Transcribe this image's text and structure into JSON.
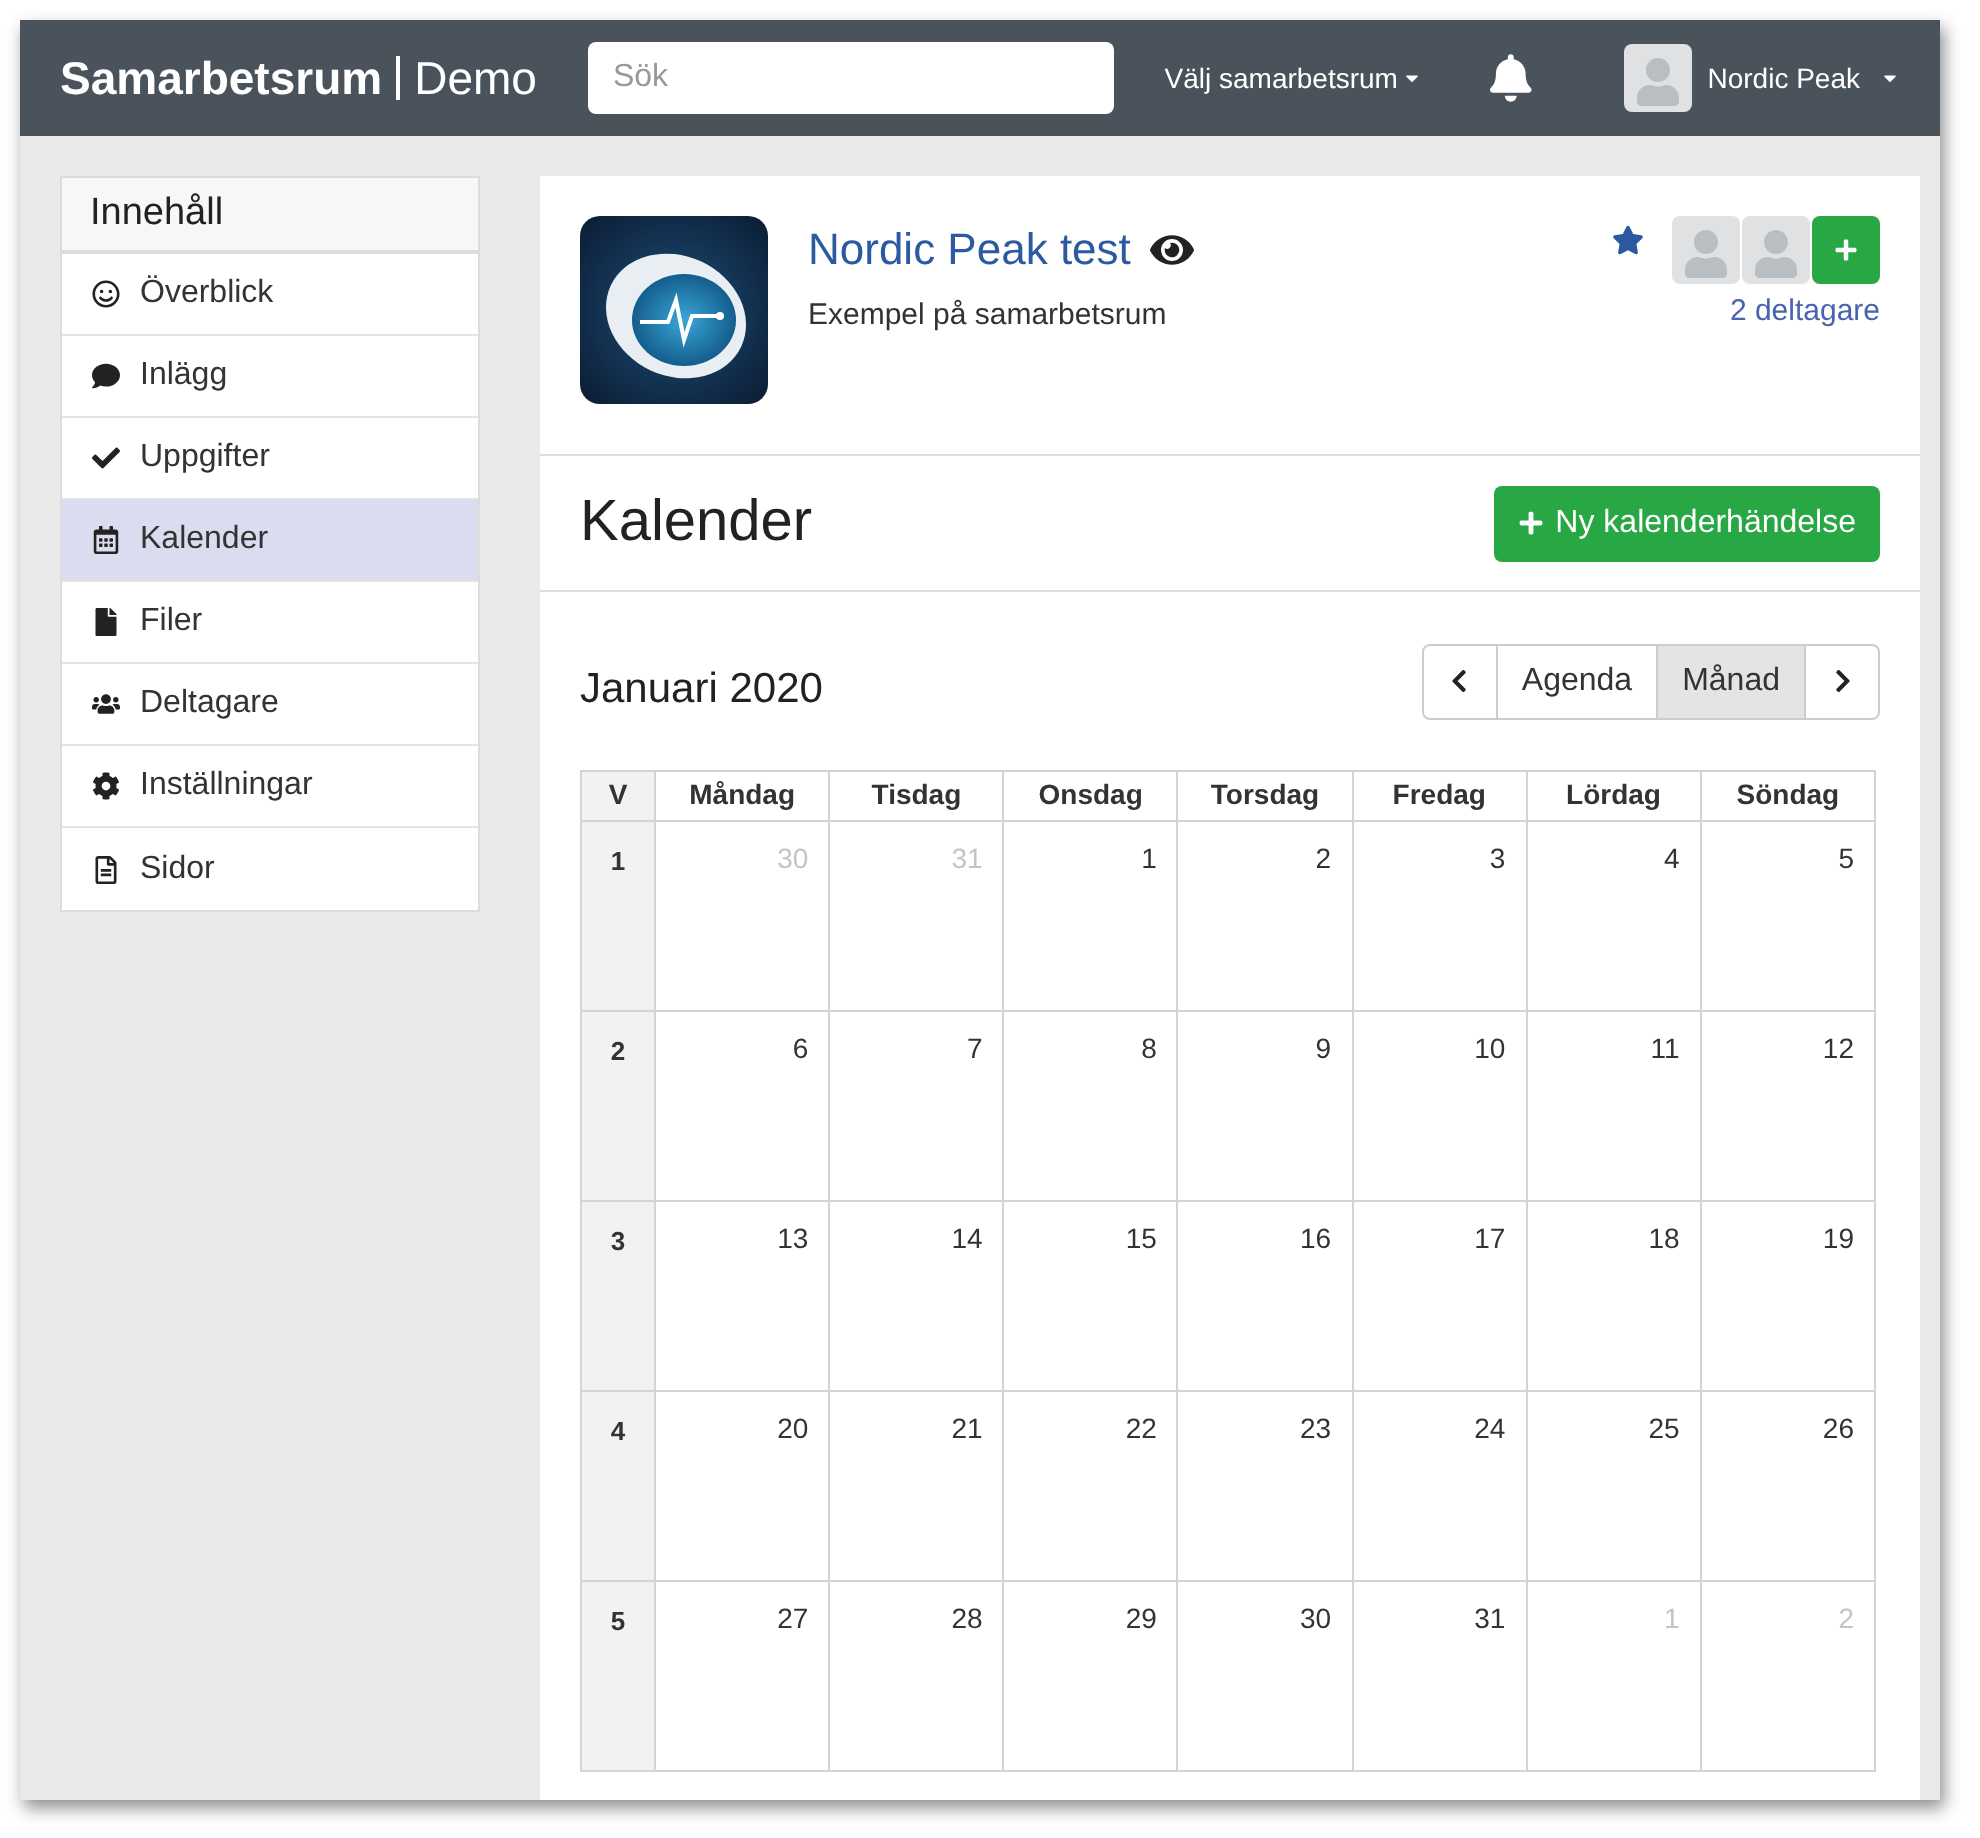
{
  "header": {
    "brand": "Samarbetsrum",
    "brand_suffix": "Demo",
    "search": {
      "placeholder": "Sök"
    },
    "workspace_menu": "Välj samarbetsrum",
    "user": "Nordic Peak"
  },
  "sidebar": {
    "title": "Innehåll",
    "items": [
      {
        "label": "Överblick",
        "selected": false
      },
      {
        "label": "Inlägg",
        "selected": false
      },
      {
        "label": "Uppgifter",
        "selected": false
      },
      {
        "label": "Kalender",
        "selected": true
      },
      {
        "label": "Filer",
        "selected": false
      },
      {
        "label": "Deltagare",
        "selected": false
      },
      {
        "label": "Inställningar",
        "selected": false
      },
      {
        "label": "Sidor",
        "selected": false
      }
    ]
  },
  "project": {
    "title": "Nordic Peak test",
    "subtitle": "Exempel på samarbetsrum",
    "participants": "2 deltagare"
  },
  "calendar": {
    "heading": "Kalender",
    "new_button": "Ny kalenderhändelse",
    "month": "Januari 2020",
    "views": [
      {
        "label": "Agenda",
        "selected": false
      },
      {
        "label": "Månad",
        "selected": true
      }
    ],
    "columns": [
      "V",
      "Måndag",
      "Tisdag",
      "Onsdag",
      "Torsdag",
      "Fredag",
      "Lördag",
      "Söndag"
    ],
    "weeks": [
      {
        "week": "1",
        "days": [
          {
            "label": "30",
            "outside": true
          },
          {
            "label": "31",
            "outside": true
          },
          {
            "label": "1",
            "outside": false
          },
          {
            "label": "2",
            "outside": false
          },
          {
            "label": "3",
            "outside": false
          },
          {
            "label": "4",
            "outside": false
          },
          {
            "label": "5",
            "outside": false
          }
        ]
      },
      {
        "week": "2",
        "days": [
          {
            "label": "6",
            "outside": false
          },
          {
            "label": "7",
            "outside": false
          },
          {
            "label": "8",
            "outside": false
          },
          {
            "label": "9",
            "outside": false
          },
          {
            "label": "10",
            "outside": false
          },
          {
            "label": "11",
            "outside": false
          },
          {
            "label": "12",
            "outside": false
          }
        ]
      },
      {
        "week": "3",
        "days": [
          {
            "label": "13",
            "outside": false
          },
          {
            "label": "14",
            "outside": false
          },
          {
            "label": "15",
            "outside": false
          },
          {
            "label": "16",
            "outside": false
          },
          {
            "label": "17",
            "outside": false
          },
          {
            "label": "18",
            "outside": false
          },
          {
            "label": "19",
            "outside": false
          }
        ]
      },
      {
        "week": "4",
        "days": [
          {
            "label": "20",
            "outside": false
          },
          {
            "label": "21",
            "outside": false
          },
          {
            "label": "22",
            "outside": false
          },
          {
            "label": "23",
            "outside": false
          },
          {
            "label": "24",
            "outside": false
          },
          {
            "label": "25",
            "outside": false
          },
          {
            "label": "26",
            "outside": false
          }
        ]
      },
      {
        "week": "5",
        "days": [
          {
            "label": "27",
            "outside": false
          },
          {
            "label": "28",
            "outside": false
          },
          {
            "label": "29",
            "outside": false
          },
          {
            "label": "30",
            "outside": false
          },
          {
            "label": "31",
            "outside": false
          },
          {
            "label": "1",
            "outside": true
          },
          {
            "label": "2",
            "outside": true
          }
        ]
      }
    ]
  }
}
